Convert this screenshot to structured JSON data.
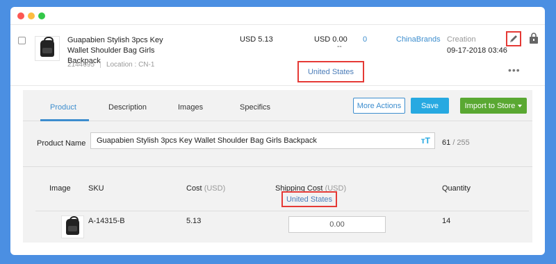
{
  "window": {
    "controls": [
      "close",
      "minimize",
      "maximize"
    ]
  },
  "product": {
    "title": "Guapabien Stylish 3pcs Key Wallet Shoulder Bag Girls Backpack",
    "id": "2144695",
    "location": "Location : CN-1",
    "price": "USD 5.13",
    "shipping": "USD 0.00",
    "shipping_dash": "--",
    "country": "United States",
    "quantity": "0",
    "supplier": "ChinaBrands",
    "created_label": "Creation",
    "created_date": "09-17-2018 03:46",
    "more": "•••"
  },
  "tabs": [
    {
      "label": "Product",
      "active": true
    },
    {
      "label": "Description"
    },
    {
      "label": "Images"
    },
    {
      "label": "Specifics"
    }
  ],
  "actions": {
    "more": "More Actions",
    "save": "Save",
    "import": "Import to Store"
  },
  "name_field": {
    "label": "Product Name",
    "value": "Guapabien Stylish 3pcs Key Wallet Shoulder Bag Girls Backpack",
    "count": "61",
    "max": "/ 255"
  },
  "sku_table": {
    "headers": {
      "image": "Image",
      "sku": "SKU",
      "cost": "Cost",
      "cost_unit": "(USD)",
      "shipping": "Shipping Cost",
      "shipping_unit": "(USD)",
      "quantity": "Quantity"
    },
    "country": "United States",
    "rows": [
      {
        "sku": "A-14315-B",
        "cost": "5.13",
        "shipping": "0.00",
        "quantity": "14"
      }
    ]
  },
  "colors": {
    "background": "#4b8fe2",
    "link": "#3c8dce",
    "save": "#27a9e1",
    "import": "#5aa832",
    "highlight": "#e53935"
  },
  "icons": [
    "pencil-icon",
    "lock-bag-icon",
    "more-icon",
    "text-size-icon",
    "caret-down-icon"
  ]
}
